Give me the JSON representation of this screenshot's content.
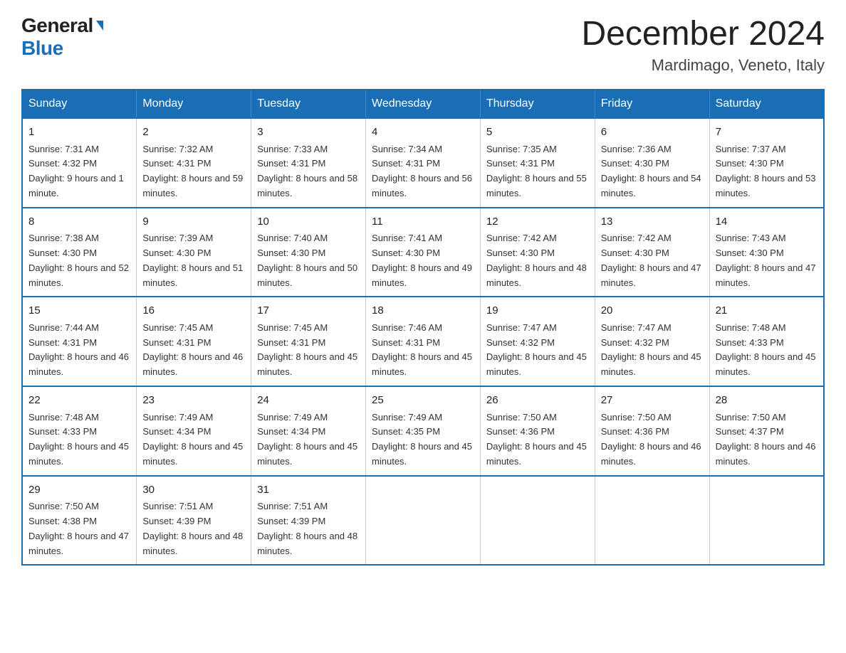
{
  "logo": {
    "general": "General",
    "blue": "Blue"
  },
  "title": "December 2024",
  "subtitle": "Mardimago, Veneto, Italy",
  "days_of_week": [
    "Sunday",
    "Monday",
    "Tuesday",
    "Wednesday",
    "Thursday",
    "Friday",
    "Saturday"
  ],
  "weeks": [
    [
      {
        "day": "1",
        "sunrise": "7:31 AM",
        "sunset": "4:32 PM",
        "daylight": "9 hours and 1 minute."
      },
      {
        "day": "2",
        "sunrise": "7:32 AM",
        "sunset": "4:31 PM",
        "daylight": "8 hours and 59 minutes."
      },
      {
        "day": "3",
        "sunrise": "7:33 AM",
        "sunset": "4:31 PM",
        "daylight": "8 hours and 58 minutes."
      },
      {
        "day": "4",
        "sunrise": "7:34 AM",
        "sunset": "4:31 PM",
        "daylight": "8 hours and 56 minutes."
      },
      {
        "day": "5",
        "sunrise": "7:35 AM",
        "sunset": "4:31 PM",
        "daylight": "8 hours and 55 minutes."
      },
      {
        "day": "6",
        "sunrise": "7:36 AM",
        "sunset": "4:30 PM",
        "daylight": "8 hours and 54 minutes."
      },
      {
        "day": "7",
        "sunrise": "7:37 AM",
        "sunset": "4:30 PM",
        "daylight": "8 hours and 53 minutes."
      }
    ],
    [
      {
        "day": "8",
        "sunrise": "7:38 AM",
        "sunset": "4:30 PM",
        "daylight": "8 hours and 52 minutes."
      },
      {
        "day": "9",
        "sunrise": "7:39 AM",
        "sunset": "4:30 PM",
        "daylight": "8 hours and 51 minutes."
      },
      {
        "day": "10",
        "sunrise": "7:40 AM",
        "sunset": "4:30 PM",
        "daylight": "8 hours and 50 minutes."
      },
      {
        "day": "11",
        "sunrise": "7:41 AM",
        "sunset": "4:30 PM",
        "daylight": "8 hours and 49 minutes."
      },
      {
        "day": "12",
        "sunrise": "7:42 AM",
        "sunset": "4:30 PM",
        "daylight": "8 hours and 48 minutes."
      },
      {
        "day": "13",
        "sunrise": "7:42 AM",
        "sunset": "4:30 PM",
        "daylight": "8 hours and 47 minutes."
      },
      {
        "day": "14",
        "sunrise": "7:43 AM",
        "sunset": "4:30 PM",
        "daylight": "8 hours and 47 minutes."
      }
    ],
    [
      {
        "day": "15",
        "sunrise": "7:44 AM",
        "sunset": "4:31 PM",
        "daylight": "8 hours and 46 minutes."
      },
      {
        "day": "16",
        "sunrise": "7:45 AM",
        "sunset": "4:31 PM",
        "daylight": "8 hours and 46 minutes."
      },
      {
        "day": "17",
        "sunrise": "7:45 AM",
        "sunset": "4:31 PM",
        "daylight": "8 hours and 45 minutes."
      },
      {
        "day": "18",
        "sunrise": "7:46 AM",
        "sunset": "4:31 PM",
        "daylight": "8 hours and 45 minutes."
      },
      {
        "day": "19",
        "sunrise": "7:47 AM",
        "sunset": "4:32 PM",
        "daylight": "8 hours and 45 minutes."
      },
      {
        "day": "20",
        "sunrise": "7:47 AM",
        "sunset": "4:32 PM",
        "daylight": "8 hours and 45 minutes."
      },
      {
        "day": "21",
        "sunrise": "7:48 AM",
        "sunset": "4:33 PM",
        "daylight": "8 hours and 45 minutes."
      }
    ],
    [
      {
        "day": "22",
        "sunrise": "7:48 AM",
        "sunset": "4:33 PM",
        "daylight": "8 hours and 45 minutes."
      },
      {
        "day": "23",
        "sunrise": "7:49 AM",
        "sunset": "4:34 PM",
        "daylight": "8 hours and 45 minutes."
      },
      {
        "day": "24",
        "sunrise": "7:49 AM",
        "sunset": "4:34 PM",
        "daylight": "8 hours and 45 minutes."
      },
      {
        "day": "25",
        "sunrise": "7:49 AM",
        "sunset": "4:35 PM",
        "daylight": "8 hours and 45 minutes."
      },
      {
        "day": "26",
        "sunrise": "7:50 AM",
        "sunset": "4:36 PM",
        "daylight": "8 hours and 45 minutes."
      },
      {
        "day": "27",
        "sunrise": "7:50 AM",
        "sunset": "4:36 PM",
        "daylight": "8 hours and 46 minutes."
      },
      {
        "day": "28",
        "sunrise": "7:50 AM",
        "sunset": "4:37 PM",
        "daylight": "8 hours and 46 minutes."
      }
    ],
    [
      {
        "day": "29",
        "sunrise": "7:50 AM",
        "sunset": "4:38 PM",
        "daylight": "8 hours and 47 minutes."
      },
      {
        "day": "30",
        "sunrise": "7:51 AM",
        "sunset": "4:39 PM",
        "daylight": "8 hours and 48 minutes."
      },
      {
        "day": "31",
        "sunrise": "7:51 AM",
        "sunset": "4:39 PM",
        "daylight": "8 hours and 48 minutes."
      },
      null,
      null,
      null,
      null
    ]
  ]
}
